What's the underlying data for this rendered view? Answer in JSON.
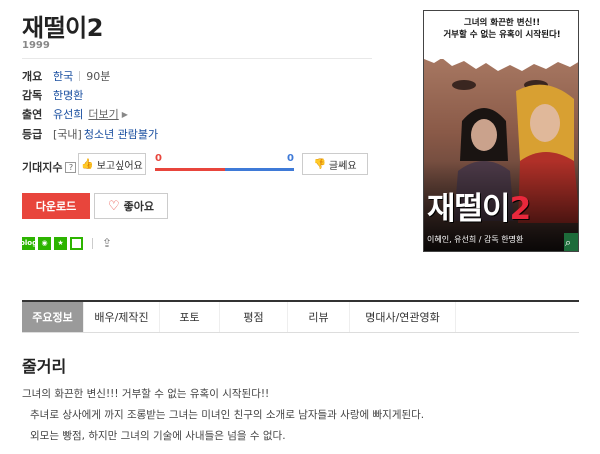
{
  "movie": {
    "title": "재떨이2",
    "year": "1999"
  },
  "info": {
    "overview_label": "개요",
    "country": "한국",
    "runtime": "90분",
    "director_label": "감독",
    "director": "한명환",
    "cast_label": "출연",
    "cast": "유선희",
    "more_label": "더보기",
    "rating_label": "등급",
    "rating_domestic": "[국내]",
    "rating_value": "청소년 관람불가"
  },
  "expectation": {
    "label": "기대지수",
    "help": "?",
    "want_label": "보고싶어요",
    "want_count": "0",
    "meh_count": "0",
    "meh_label": "글쎄요",
    "want_ratio": 0.5
  },
  "actions": {
    "download_label": "다운로드",
    "like_label": "좋아요"
  },
  "share": {
    "blog": "blog"
  },
  "poster": {
    "top_text_line1": "그녀의 화끈한 변신!!",
    "top_text_line2": "거부할 수 없는 유혹이 시작된다!",
    "big_title": "재떨이",
    "big_number": "2",
    "credits": "이혜인, 유선희 / 감독 한명환"
  },
  "tabs": [
    {
      "label": "주요정보"
    },
    {
      "label": "배우/제작진"
    },
    {
      "label": "포토"
    },
    {
      "label": "평점"
    },
    {
      "label": "리뷰"
    },
    {
      "label": "명대사/연관영화"
    }
  ],
  "synopsis": {
    "heading": "줄거리",
    "line1": "그녀의 화끈한 변신!!! 거부할 수 없는 유혹이 시작된다!!",
    "line2": "추녀로 상사에게 까지 조롱받는 그녀는 미녀인 친구의 소개로 남자들과 사랑에 빠지게된다.",
    "line3": "외모는 빵점, 하지만 그녀의 기술에 사내들은 넘을 수 없다."
  },
  "colors": {
    "accent_red": "#e8453c",
    "accent_blue": "#3f7ad7",
    "share_green": "#2db400"
  }
}
